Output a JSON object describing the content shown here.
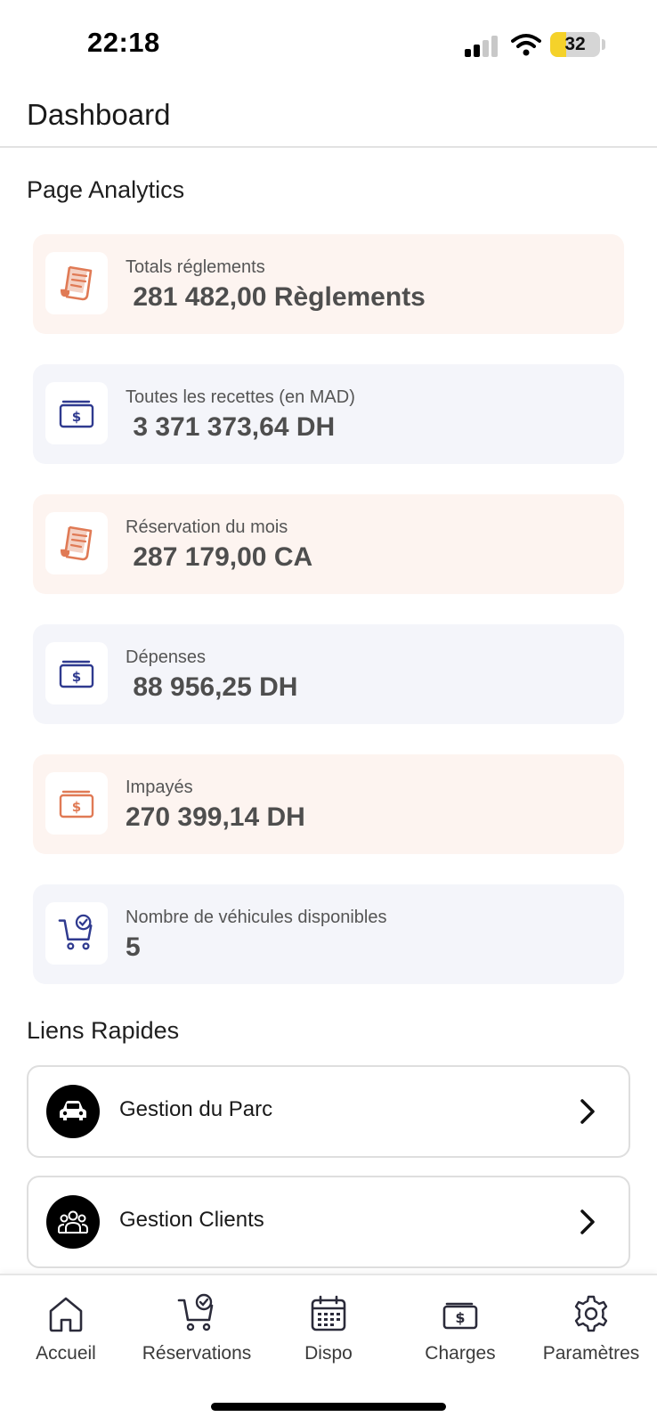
{
  "status_bar": {
    "time": "22:18",
    "battery_level": "32",
    "battery_fraction": 0.32
  },
  "header": {
    "title": "Dashboard"
  },
  "analytics": {
    "section_title": "Page Analytics",
    "cards": [
      {
        "label": "Totals réglements",
        "value": " 281 482,00 Règlements",
        "icon": "receipt-icon",
        "theme": "peach"
      },
      {
        "label": "Toutes les recettes (en MAD)",
        "value": " 3 371 373,64 DH",
        "icon": "wallet-icon",
        "theme": "blue"
      },
      {
        "label": "Réservation du mois",
        "value": " 287 179,00 CA",
        "icon": "receipt-icon",
        "theme": "peach"
      },
      {
        "label": "Dépenses",
        "value": " 88 956,25 DH",
        "icon": "wallet-icon",
        "theme": "blue"
      },
      {
        "label": "Impayés",
        "value": "270 399,14 DH",
        "icon": "wallet-icon",
        "theme": "peach"
      },
      {
        "label": "Nombre de véhicules disponibles",
        "value": "5",
        "icon": "cart-check-icon",
        "theme": "blue"
      }
    ]
  },
  "quick_links": {
    "section_title": "Liens Rapides",
    "items": [
      {
        "label": "Gestion du Parc",
        "icon": "car-icon"
      },
      {
        "label": "Gestion Clients",
        "icon": "users-icon"
      }
    ]
  },
  "bottom_nav": {
    "items": [
      {
        "label": "Accueil",
        "icon": "home-icon"
      },
      {
        "label": "Réservations",
        "icon": "cart-check-icon"
      },
      {
        "label": "Dispo",
        "icon": "calendar-icon"
      },
      {
        "label": "Charges",
        "icon": "wallet-icon"
      },
      {
        "label": "Paramètres",
        "icon": "gear-icon"
      }
    ]
  },
  "colors": {
    "peach_card": "#fdf4f0",
    "blue_card": "#f4f5fa",
    "peach_icon": "#e07a55",
    "blue_icon": "#2f3a8f",
    "battery_yellow": "#f5d22a"
  }
}
